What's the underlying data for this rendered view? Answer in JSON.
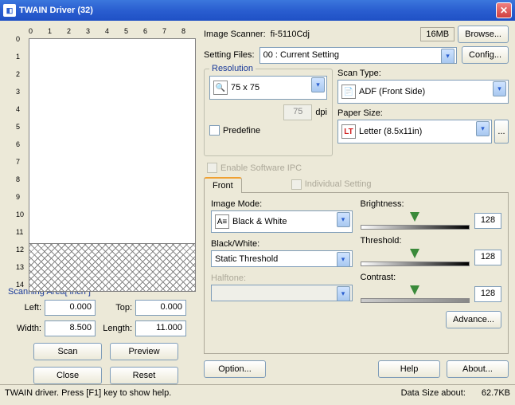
{
  "title": "TWAIN Driver (32)",
  "scanner_label": "Image Scanner:",
  "scanner_value": "fi-5110Cdj",
  "memory": "16MB",
  "browse_btn": "Browse...",
  "setting_label": "Setting Files:",
  "setting_value": "00 : Current Setting",
  "config_btn": "Config...",
  "resolution": {
    "legend": "Resolution",
    "value": "75 x 75",
    "dpi_value": "75",
    "dpi_label": "dpi",
    "predefine": "Predefine"
  },
  "scantype": {
    "label": "Scan Type:",
    "value": "ADF (Front Side)"
  },
  "papersize": {
    "label": "Paper Size:",
    "value": "Letter (8.5x11in)"
  },
  "enable_ipc": "Enable Software IPC",
  "tab_front": "Front",
  "individual": "Individual Setting",
  "image_mode": {
    "label": "Image Mode:",
    "value": "Black & White"
  },
  "blackwhite": {
    "label": "Black/White:",
    "value": "Static Threshold"
  },
  "halftone": {
    "label": "Halftone:",
    "value": ""
  },
  "brightness": {
    "label": "Brightness:",
    "value": "128"
  },
  "threshold": {
    "label": "Threshold:",
    "value": "128"
  },
  "contrast": {
    "label": "Contrast:",
    "value": "128"
  },
  "advance_btn": "Advance...",
  "scan_area_legend": "Scanning Area[ inch ]",
  "coords": {
    "left_lbl": "Left:",
    "left": "0.000",
    "top_lbl": "Top:",
    "top": "0.000",
    "width_lbl": "Width:",
    "width": "8.500",
    "length_lbl": "Length:",
    "length": "11.000"
  },
  "btns": {
    "scan": "Scan",
    "preview": "Preview",
    "close": "Close",
    "reset": "Reset",
    "option": "Option...",
    "help": "Help",
    "about": "About..."
  },
  "status_left": "TWAIN driver. Press [F1] key to show help.",
  "status_right_lbl": "Data Size about:",
  "status_right_val": "62.7KB",
  "ruler_h": [
    "0",
    "1",
    "2",
    "3",
    "4",
    "5",
    "6",
    "7",
    "8"
  ],
  "ruler_v": [
    "0",
    "1",
    "2",
    "3",
    "4",
    "5",
    "6",
    "7",
    "8",
    "9",
    "10",
    "11",
    "12",
    "13",
    "14"
  ]
}
